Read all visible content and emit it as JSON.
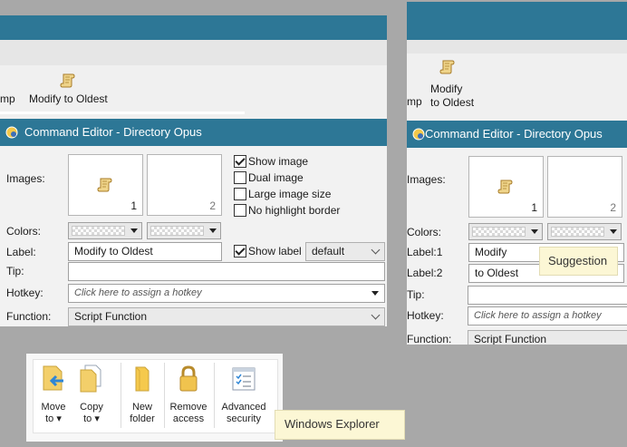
{
  "left_editor": {
    "toolbar": {
      "partial_button_label": "mp",
      "modify_button_label": "Modify to Oldest"
    },
    "title": "Command Editor - Directory Opus",
    "images_label": "Images:",
    "image_slot_1": "1",
    "image_slot_2": "2",
    "show_image": "Show image",
    "dual_image": "Dual image",
    "large_image_size": "Large image size",
    "no_highlight_border": "No highlight border",
    "colors_label": "Colors:",
    "label_label": "Label:",
    "label_value": "Modify to Oldest",
    "show_label": "Show label",
    "show_label_mode": "default",
    "tip_label": "Tip:",
    "hotkey_label": "Hotkey:",
    "hotkey_placeholder": "Click here to assign a hotkey",
    "function_label": "Function:",
    "function_value": "Script Function",
    "checkbox_states": {
      "show_image": true,
      "dual_image": false,
      "large_image_size": false,
      "no_highlight_border": false,
      "show_label": true
    }
  },
  "right_editor": {
    "toolbar": {
      "partial_button_label": "mp",
      "modify_line1": "Modify",
      "modify_line2": "to Oldest"
    },
    "title": "Command Editor - Directory Opus",
    "images_label": "Images:",
    "image_slot_1": "1",
    "image_slot_2": "2",
    "colors_label": "Colors:",
    "label1_label": "Label:1",
    "label1_value": "Modify",
    "label2_label": "Label:2",
    "label2_value": "to Oldest",
    "suggestion_tooltip": "Suggestion",
    "tip_label": "Tip:",
    "hotkey_label": "Hotkey:",
    "hotkey_placeholder": "Click here to assign a hotkey",
    "function_label": "Function:",
    "function_value": "Script Function"
  },
  "explorer_ribbon": {
    "move_to_1": "Move",
    "move_to_2": "to",
    "copy_to_1": "Copy",
    "copy_to_2": "to",
    "new_folder_1": "New",
    "new_folder_2": "folder",
    "remove_access_1": "Remove",
    "remove_access_2": "access",
    "advanced_security_1": "Advanced",
    "advanced_security_2": "security",
    "tooltip": "Windows Explorer"
  },
  "colors": {
    "accent": "#2d7796",
    "tooltip_bg": "#fcf7d5",
    "folder_yellow": "#f5c94c",
    "move_arrow_blue": "#2f86d6"
  },
  "icons": [
    "scroll-icon",
    "dopus-logo-icon",
    "dropdown-arrow-icon",
    "move-to-icon",
    "copy-to-icon",
    "new-folder-icon",
    "lock-icon",
    "advanced-security-icon"
  ]
}
